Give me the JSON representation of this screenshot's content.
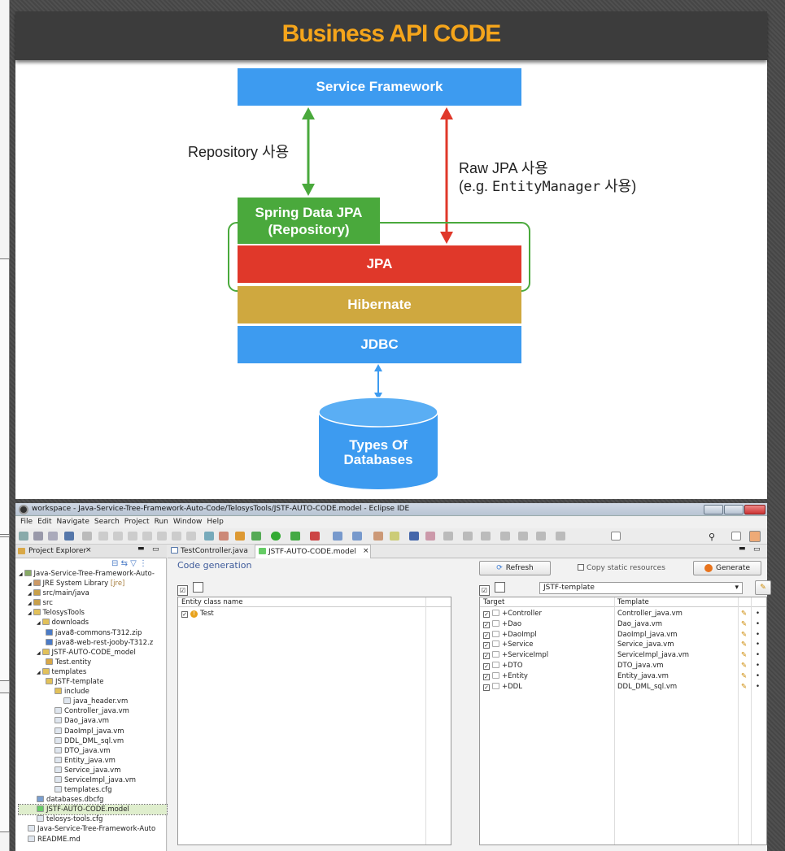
{
  "slide": {
    "title": "Business API CODE",
    "blocks": {
      "service_framework": "Service Framework",
      "spring_data_jpa_line1": "Spring Data JPA",
      "spring_data_jpa_line2": "(Repository)",
      "jpa": "JPA",
      "hibernate": "Hibernate",
      "jdbc": "JDBC",
      "db_line1": "Types Of",
      "db_line2": "Databases"
    },
    "labels": {
      "repository": "Repository 사용",
      "raw_jpa_line1": "Raw JPA 사용",
      "raw_jpa_line2a": "(e.g. ",
      "raw_jpa_line2b": "EntityManager",
      "raw_jpa_line2c": " 사용)"
    },
    "colors": {
      "title": "#f5a51b",
      "blue": "#3d9bf0",
      "green": "#4aa93c",
      "red": "#e0382a",
      "gold": "#cfa83f"
    }
  },
  "eclipse": {
    "window_title": "workspace - Java-Service-Tree-Framework-Auto-Code/TelosysTools/JSTF-AUTO-CODE.model - Eclipse IDE",
    "menu": [
      "File",
      "Edit",
      "Navigate",
      "Search",
      "Project",
      "Run",
      "Window",
      "Help"
    ],
    "explorer_tab": "Project Explorer",
    "tree": [
      {
        "label": "Java-Service-Tree-Framework-Auto-",
        "indent": 0,
        "icon": "project-icon"
      },
      {
        "label": "JRE System Library",
        "suffix": " [jre]",
        "indent": 1,
        "icon": "library-icon"
      },
      {
        "label": "src/main/java",
        "indent": 1,
        "icon": "source-folder-icon"
      },
      {
        "label": "src",
        "indent": 1,
        "icon": "source-folder-icon"
      },
      {
        "label": "TelosysTools",
        "indent": 1,
        "icon": "folder-icon"
      },
      {
        "label": "downloads",
        "indent": 2,
        "icon": "folder-icon"
      },
      {
        "label": "java8-commons-T312.zip",
        "indent": 3,
        "icon": "zip-icon"
      },
      {
        "label": "java8-web-rest-jooby-T312.z",
        "indent": 3,
        "icon": "zip-icon"
      },
      {
        "label": "JSTF-AUTO-CODE_model",
        "indent": 2,
        "icon": "folder-icon"
      },
      {
        "label": "Test.entity",
        "indent": 3,
        "icon": "entity-file-icon"
      },
      {
        "label": "templates",
        "indent": 2,
        "icon": "folder-icon"
      },
      {
        "label": "JSTF-template",
        "indent": 3,
        "icon": "folder-icon"
      },
      {
        "label": "include",
        "indent": 4,
        "icon": "folder-icon"
      },
      {
        "label": "java_header.vm",
        "indent": 5,
        "icon": "file-icon"
      },
      {
        "label": "Controller_java.vm",
        "indent": 4,
        "icon": "file-icon"
      },
      {
        "label": "Dao_java.vm",
        "indent": 4,
        "icon": "file-icon"
      },
      {
        "label": "DaoImpl_java.vm",
        "indent": 4,
        "icon": "file-icon"
      },
      {
        "label": "DDL_DML_sql.vm",
        "indent": 4,
        "icon": "file-icon"
      },
      {
        "label": "DTO_java.vm",
        "indent": 4,
        "icon": "file-icon"
      },
      {
        "label": "Entity_java.vm",
        "indent": 4,
        "icon": "file-icon"
      },
      {
        "label": "Service_java.vm",
        "indent": 4,
        "icon": "file-icon"
      },
      {
        "label": "ServiceImpl_java.vm",
        "indent": 4,
        "icon": "file-icon"
      },
      {
        "label": "templates.cfg",
        "indent": 4,
        "icon": "file-icon"
      },
      {
        "label": "databases.dbcfg",
        "indent": 2,
        "icon": "config-file-icon"
      },
      {
        "label": "JSTF-AUTO-CODE.model",
        "indent": 2,
        "icon": "model-file-icon",
        "selected": true
      },
      {
        "label": "telosys-tools.cfg",
        "indent": 2,
        "icon": "file-icon"
      },
      {
        "label": "Java-Service-Tree-Framework-Auto",
        "indent": 1,
        "icon": "file-icon"
      },
      {
        "label": "README.md",
        "indent": 1,
        "icon": "file-icon"
      }
    ],
    "editor_tabs": [
      "TestController.java",
      "JSTF-AUTO-CODE.model"
    ],
    "code_generation_title": "Code generation",
    "refresh_label": "Refresh",
    "copy_static_label": "Copy static resources",
    "generate_label": "Generate",
    "template_select": "JSTF-template",
    "entity_header": "Entity class name",
    "entities": [
      "Test"
    ],
    "target_header": "Target",
    "template_header": "Template",
    "targets": [
      {
        "target": "+Controller",
        "template": "Controller_java.vm"
      },
      {
        "target": "+Dao",
        "template": "Dao_java.vm"
      },
      {
        "target": "+DaoImpl",
        "template": "DaoImpl_java.vm"
      },
      {
        "target": "+Service",
        "template": "Service_java.vm"
      },
      {
        "target": "+ServiceImpl",
        "template": "ServiceImpl_java.vm"
      },
      {
        "target": "+DTO",
        "template": "DTO_java.vm"
      },
      {
        "target": "+Entity",
        "template": "Entity_java.vm"
      },
      {
        "target": "+DDL",
        "template": "DDL_DML_sql.vm"
      }
    ]
  }
}
